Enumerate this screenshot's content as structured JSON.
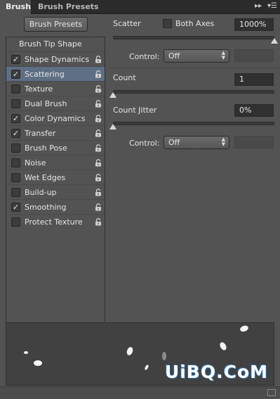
{
  "tabs": [
    {
      "label": "Brush"
    },
    {
      "label": "Brush Presets"
    }
  ],
  "panel_icons": {
    "collapse": "double-chevron-right-icon",
    "menu": "panel-menu-icon"
  },
  "brush_presets_button": "Brush Presets",
  "list": {
    "header": "Brush Tip Shape",
    "items": [
      {
        "label": "Shape Dynamics",
        "checked": true
      },
      {
        "label": "Scattering",
        "checked": true,
        "selected": true
      },
      {
        "label": "Texture",
        "checked": false
      },
      {
        "label": "Dual Brush",
        "checked": false
      },
      {
        "label": "Color Dynamics",
        "checked": true
      },
      {
        "label": "Transfer",
        "checked": true
      },
      {
        "label": "Brush Pose",
        "checked": false
      },
      {
        "label": "Noise",
        "checked": false
      },
      {
        "label": "Wet Edges",
        "checked": false
      },
      {
        "label": "Build-up",
        "checked": false
      },
      {
        "label": "Smoothing",
        "checked": true
      },
      {
        "label": "Protect Texture",
        "checked": false
      }
    ]
  },
  "scatter": {
    "label": "Scatter",
    "both_axes_label": "Both Axes",
    "both_axes_checked": false,
    "value": "1000%",
    "slider_level": 1.0,
    "control_label": "Control:",
    "control_value": "Off"
  },
  "count": {
    "label": "Count",
    "value": "1",
    "slider_level": 0.0
  },
  "count_jitter": {
    "label": "Count Jitter",
    "value": "0%",
    "slider_level": 0.0,
    "control_label": "Control:",
    "control_value": "Off"
  },
  "watermark": "UiBQ.CoM"
}
